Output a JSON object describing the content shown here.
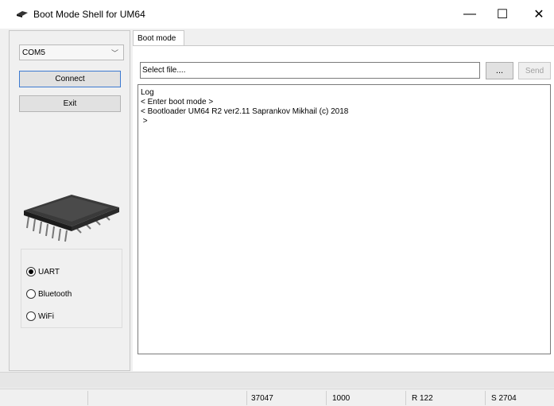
{
  "window": {
    "title": "Boot Mode Shell for UM64",
    "minimize": "—",
    "maximize": "☐",
    "close": "✕"
  },
  "left": {
    "port": {
      "value": "COM5",
      "chevron": "﹀"
    },
    "connect_label": "Connect",
    "exit_label": "Exit",
    "radios": [
      {
        "label": "UART",
        "checked": true
      },
      {
        "label": "Bluetooth",
        "checked": false
      },
      {
        "label": "WiFi",
        "checked": false
      }
    ]
  },
  "tabs": [
    {
      "label": "Boot mode",
      "active": true
    }
  ],
  "file": {
    "value": "Select file....",
    "browse_label": "...",
    "send_label": "Send"
  },
  "log": {
    "lines": [
      "Log",
      "< Enter boot mode >",
      "< Bootloader UM64 R2 ver2.11 Saprankov Mikhail (c) 2018",
      " >"
    ]
  },
  "status": {
    "cells": [
      "37047",
      "1000",
      "R 122",
      "S 2704"
    ]
  },
  "colors": {
    "accent_border": "#3d7ad1",
    "background": "#f0f0f0"
  }
}
